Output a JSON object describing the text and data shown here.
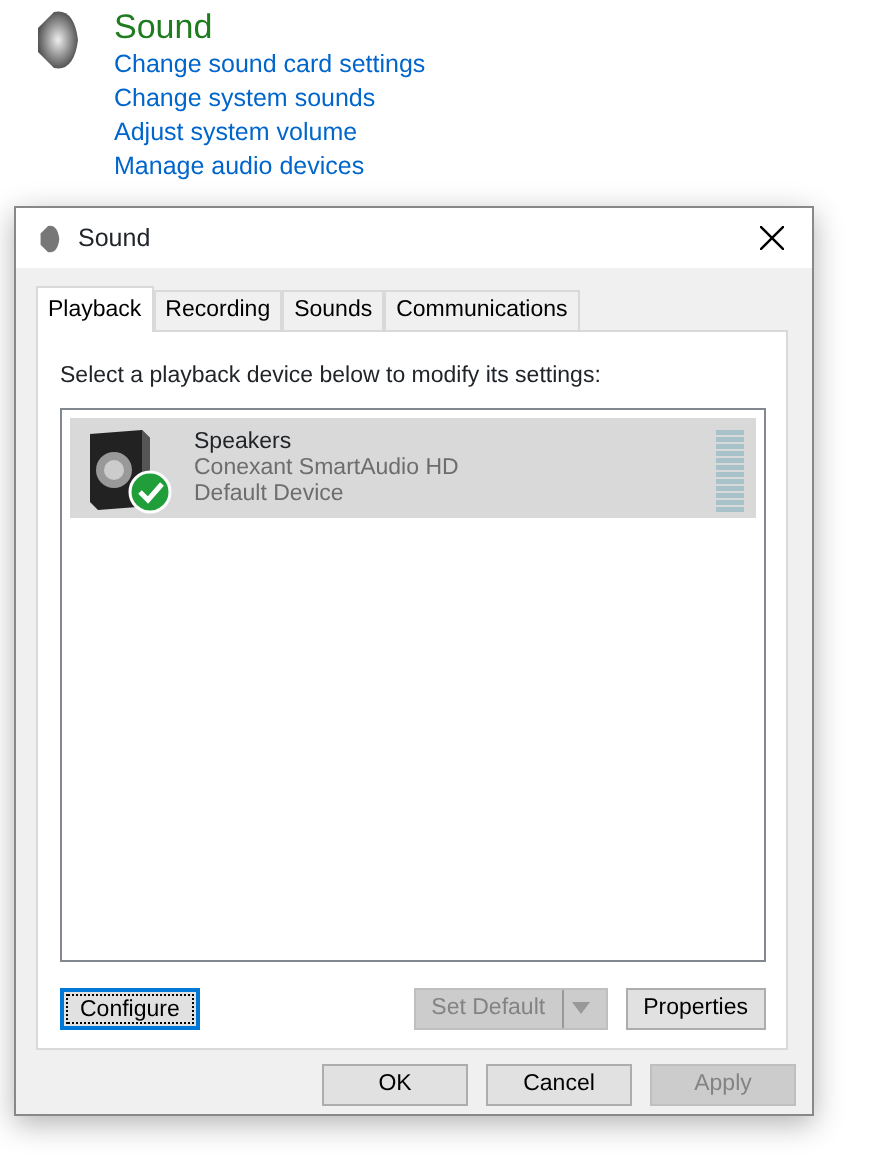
{
  "background": {
    "heading": "Sound",
    "links": [
      "Change sound card settings",
      "Change system sounds",
      "Adjust system volume",
      "Manage audio devices"
    ]
  },
  "window": {
    "title": "Sound"
  },
  "tabs": [
    {
      "label": "Playback",
      "selected": true
    },
    {
      "label": "Recording",
      "selected": false
    },
    {
      "label": "Sounds",
      "selected": false
    },
    {
      "label": "Communications",
      "selected": false
    }
  ],
  "instruction": "Select a playback device below to modify its settings:",
  "devices": [
    {
      "name": "Speakers",
      "driver": "Conexant SmartAudio HD",
      "status": "Default Device",
      "selected": true,
      "is_default": true
    }
  ],
  "panel_buttons": [
    {
      "label": "Configure",
      "disabled": false,
      "focused": true,
      "kind": "plain"
    },
    {
      "label": "Set Default",
      "disabled": true,
      "focused": false,
      "kind": "split"
    },
    {
      "label": "Properties",
      "disabled": false,
      "focused": false,
      "kind": "plain"
    }
  ],
  "buttons": [
    {
      "label": "OK",
      "disabled": false
    },
    {
      "label": "Cancel",
      "disabled": false
    },
    {
      "label": "Apply",
      "disabled": true
    }
  ]
}
